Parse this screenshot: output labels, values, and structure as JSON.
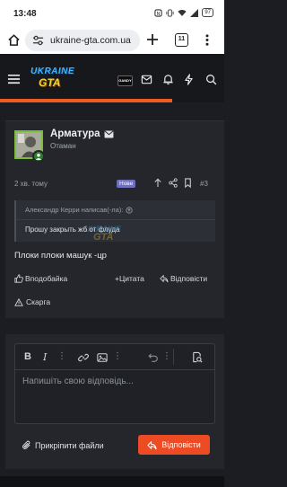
{
  "status_bar": {
    "time": "13:48",
    "battery": "97"
  },
  "browser": {
    "url": "ukraine-gta.com.ua",
    "tab_count": "11"
  },
  "site": {
    "logo_top": "UKRAINE",
    "logo_bottom": "GTA",
    "avatar_label": "GANDY"
  },
  "post": {
    "author": "Арматура",
    "role": "Отаман",
    "time": "2 хв. тому",
    "badge": "Нове",
    "number": "#3",
    "quote": {
      "header": "Александр Керри написав(-ла):",
      "text": "Прошу закрыть жб от флуда"
    },
    "text": "Плоки плоки машук -цр",
    "actions": {
      "like": "Вподобайка",
      "quote": "+Цитата",
      "reply": "Відповісти",
      "report": "Скарга"
    }
  },
  "editor": {
    "placeholder": "Напишіть свою відповідь...",
    "attach": "Прикріпити файли",
    "submit": "Відповісти"
  },
  "colors": {
    "accent": "#f05a23",
    "button": "#ec4b24",
    "badge": "#6e6fbf",
    "online": "#2f7d32"
  }
}
